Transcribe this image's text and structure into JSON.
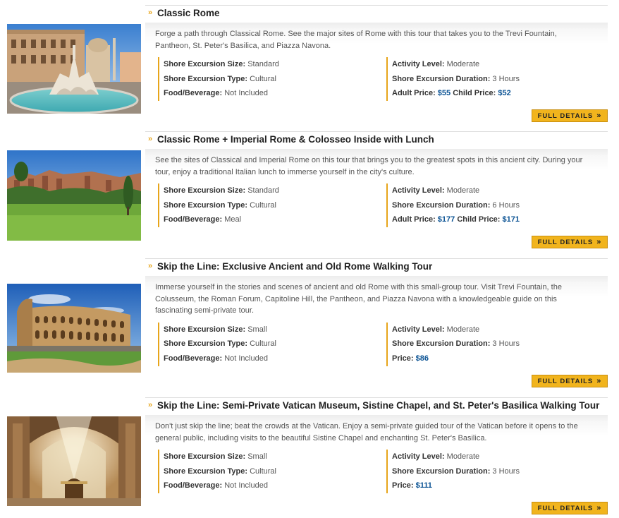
{
  "labels": {
    "size": "Shore Excursion Size:",
    "type": "Shore Excursion Type:",
    "food": "Food/Beverage:",
    "activity": "Activity Level:",
    "duration": "Shore Excursion Duration:",
    "adult_price": "Adult Price:",
    "child_price": "Child Price:",
    "price": "Price:",
    "full_details": "FULL DETAILS",
    "chevron": "»",
    "button_arrow": "»"
  },
  "tours": [
    {
      "title": "Classic Rome",
      "image": "piazza-navona-fountain-photo",
      "description": "Forge a path through Classical Rome. See the major sites of Rome with this tour that takes you to the Trevi Fountain, Pantheon, St. Peter's Basilica, and Piazza Navona.",
      "size": "Standard",
      "type": "Cultural",
      "food": "Not Included",
      "activity": "Moderate",
      "duration": "3 Hours",
      "adult_price": "$55",
      "child_price": "$52"
    },
    {
      "title": "Classic Rome + Imperial Rome & Colosseo Inside with Lunch",
      "image": "palatine-hill-ruins-photo",
      "description": "See the sites of Classical and Imperial Rome on this tour that brings you to the greatest spots in this ancient city. During your tour, enjoy a traditional Italian lunch to immerse yourself in the city's culture.",
      "size": "Standard",
      "type": "Cultural",
      "food": "Meal",
      "activity": "Moderate",
      "duration": "6 Hours",
      "adult_price": "$177",
      "child_price": "$171"
    },
    {
      "title": "Skip the Line: Exclusive Ancient and Old Rome Walking Tour",
      "image": "colosseum-photo",
      "description": "Immerse yourself in the stories and scenes of ancient and old Rome with this small-group tour. Visit Trevi Fountain, the Colusseum, the Roman Forum, Capitoline Hill, the Pantheon, and Piazza Navona with a knowledgeable guide on this fascinating semi-private tour.",
      "size": "Small",
      "type": "Cultural",
      "food": "Not Included",
      "activity": "Moderate",
      "duration": "3 Hours",
      "price": "$86"
    },
    {
      "title": "Skip the Line: Semi-Private Vatican Museum, Sistine Chapel, and St. Peter's Basilica Walking Tour",
      "image": "st-peters-basilica-interior-photo",
      "description": "Don't just skip the line; beat the crowds at the Vatican. Enjoy a semi-private guided tour of the Vatican before it opens to the general public, including visits to the beautiful Sistine Chapel and enchanting St. Peter's Basilica.",
      "size": "Small",
      "type": "Cultural",
      "food": "Not Included",
      "activity": "Moderate",
      "duration": "3 Hours",
      "price": "$111"
    }
  ]
}
